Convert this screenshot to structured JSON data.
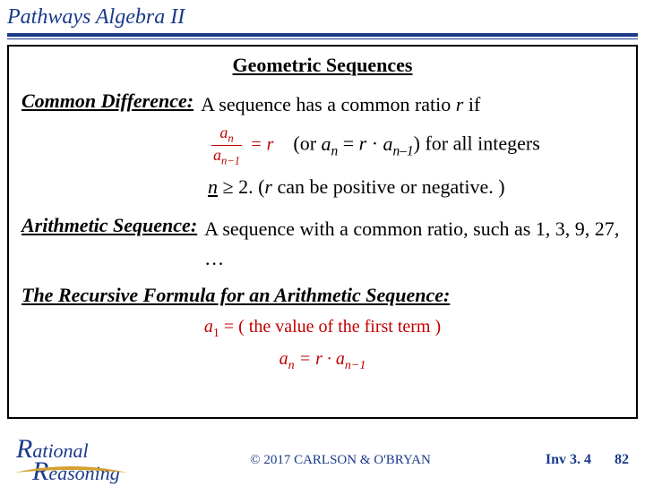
{
  "header": {
    "title": "Pathways Algebra II"
  },
  "box": {
    "section_title": "Geometric Sequences",
    "term1": "Common Difference:",
    "def1_a": "A sequence has a common ratio ",
    "def1_r": "r",
    "def1_b": " if",
    "frac_num": "a",
    "frac_num_sub": "n",
    "frac_den": "a",
    "frac_den_sub": "n−1",
    "frac_eq": " = r",
    "paren_pre": "(or ",
    "paren_an": "a",
    "paren_ansub": "n",
    "paren_eq": " = ",
    "paren_r": "r",
    "paren_dot": " · ",
    "paren_an2": "a",
    "paren_an2sub": "n–1",
    "paren_post": ") for all integers",
    "line3a": "n",
    "line3b": " ≥ 2. (",
    "line3c": "r",
    "line3d": " can be positive or negative. )",
    "term2": "Arithmetic Sequence:",
    "def2": "A sequence with a common ratio, such as 1, 3, 9, 27, …",
    "subtitle": "The Recursive Formula for an Arithmetic Sequence:",
    "rec1_a": "a",
    "rec1_sub": "1",
    "rec1_rest": " = ( the value of the first term )",
    "rec2_a": "a",
    "rec2_sub": "n",
    "rec2_mid": " = r · ",
    "rec2_a2": "a",
    "rec2_sub2": "n−1"
  },
  "footer": {
    "logo1a": "R",
    "logo1b": "ational",
    "logo2a": "R",
    "logo2b": "easoning",
    "copyright": "© 2017 CARLSON & O'BRYAN",
    "inv": "Inv 3. 4",
    "page": "82"
  }
}
